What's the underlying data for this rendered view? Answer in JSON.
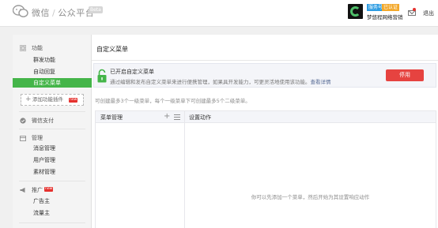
{
  "header": {
    "brand_name": "微信",
    "brand_sep": "/",
    "brand_sub": "公众平台",
    "beta_badge": "Beta",
    "account_type": "服务号",
    "account_verified": "已认证",
    "account_name": "梦悠程网络营销",
    "logout_label": "退出"
  },
  "sidebar": {
    "sections": {
      "function": {
        "label": "功能",
        "items": [
          "群发功能",
          "自动回复",
          "自定义菜单"
        ],
        "active": "自定义菜单"
      },
      "add_plugin": {
        "label": "添加功能插件",
        "badge": "new"
      },
      "pay": {
        "label": "微信支付"
      },
      "manage": {
        "label": "管理",
        "items": [
          "消息管理",
          "用户管理",
          "素材管理"
        ]
      },
      "promote": {
        "label": "推广",
        "badge": "new",
        "items": [
          "广告主",
          "流量主"
        ]
      }
    }
  },
  "main": {
    "title": "自定义菜单",
    "notice": {
      "title": "已开启自定义菜单",
      "desc": "通过编辑和发布自定义菜单来进行便携管理，如果具开发能力，可更灵活地使用该功能。",
      "link": "查看详情"
    },
    "disable_button": "停用",
    "hint": "可创建最多3个一级菜单，每个一级菜单下可创建最多5个二级菜单。",
    "panel": {
      "left_title": "菜单管理",
      "right_title": "设置动作",
      "add_icon": "+",
      "empty_hint": "你可以先添加一个菜单，然后开始为其设置响应动作"
    }
  },
  "colors": {
    "accent_green": "#44b549",
    "danger_red": "#e64340",
    "link_blue": "#576b95"
  }
}
